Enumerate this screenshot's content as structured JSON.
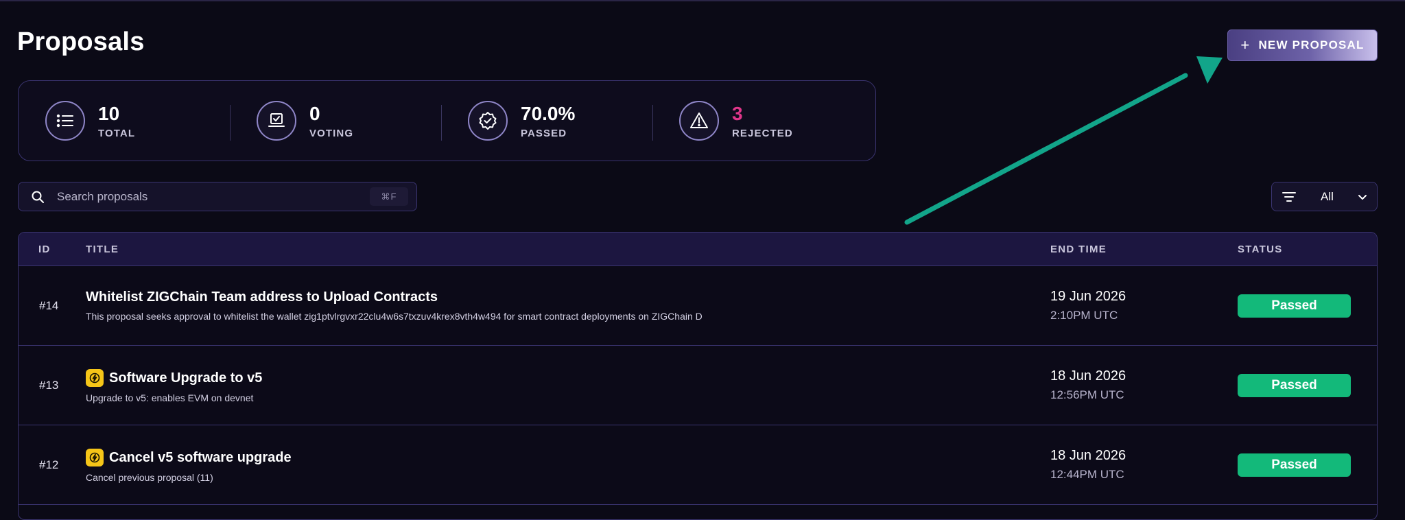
{
  "page": {
    "title": "Proposals"
  },
  "header": {
    "new_proposal_label": "NEW PROPOSAL",
    "plus_glyph": "+"
  },
  "stats": [
    {
      "icon": "list-icon",
      "value": "10",
      "label": "TOTAL"
    },
    {
      "icon": "vote-box-icon",
      "value": "0",
      "label": "VOTING"
    },
    {
      "icon": "badge-check-icon",
      "value": "70.0%",
      "label": "PASSED"
    },
    {
      "icon": "warning-triangle-icon",
      "value": "3",
      "label": "REJECTED",
      "color": "#e0368a"
    }
  ],
  "search": {
    "placeholder": "Search proposals",
    "shortcut": "⌘F"
  },
  "filter": {
    "selected": "All"
  },
  "table": {
    "headers": {
      "id": "ID",
      "title": "TITLE",
      "end_time": "END TIME",
      "status": "STATUS"
    },
    "rows": [
      {
        "id": "#14",
        "title": "Whitelist ZIGChain Team address to Upload Contracts",
        "description": "This proposal seeks approval to whitelist the wallet zig1ptvlrgvxr22clu4w6s7txzuv4krex8vth4w494 for smart contract deployments on ZIGChain D",
        "date": "19 Jun 2026",
        "time": "2:10PM UTC",
        "status": "Passed",
        "upgrade_badge": false
      },
      {
        "id": "#13",
        "title": "Software Upgrade to v5",
        "description": "Upgrade to v5: enables EVM on devnet",
        "date": "18 Jun 2026",
        "time": "12:56PM UTC",
        "status": "Passed",
        "upgrade_badge": true
      },
      {
        "id": "#12",
        "title": "Cancel v5 software upgrade",
        "description": "Cancel previous proposal (11)",
        "date": "18 Jun 2026",
        "time": "12:44PM UTC",
        "status": "Passed",
        "upgrade_badge": true
      }
    ]
  },
  "colors": {
    "background": "#0b0a16",
    "accent": "#6d62a8",
    "passed": "#13b97a",
    "rejected": "#e0368a",
    "annotation_arrow": "#12a58a"
  }
}
